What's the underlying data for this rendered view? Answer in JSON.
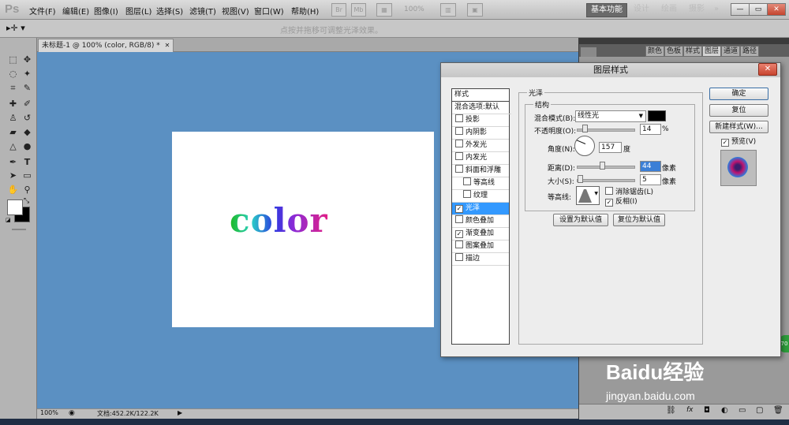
{
  "app": {
    "logo": "Ps"
  },
  "menu": [
    "文件(F)",
    "编辑(E)",
    "图像(I)",
    "图层(L)",
    "选择(S)",
    "滤镜(T)",
    "视图(V)",
    "窗口(W)",
    "帮助(H)"
  ],
  "menubar_tools": {
    "br": "Br",
    "mb": "Mb",
    "zoom": "100%"
  },
  "workspaces": [
    "基本功能",
    "设计",
    "绘画",
    "摄影",
    "»"
  ],
  "window_controls": [
    "—",
    "▭",
    "✕"
  ],
  "options_bar": {
    "hint": "点按并拖移可调整光泽效果。"
  },
  "document": {
    "tab_label": "未标题-1 @ 100% (color, RGB/8) *",
    "tab_close": "✕",
    "canvas_text": "color",
    "status_zoom": "100%",
    "status_doc": "文档:452.2K/122.2K"
  },
  "panel_tabs": [
    "颜色",
    "色板",
    "样式",
    "图层",
    "通道",
    "路径"
  ],
  "layer_style_dialog": {
    "title": "图层样式",
    "close": "✕",
    "styles_header": "样式",
    "styles": [
      {
        "label": "混合选项:默认",
        "checkbox": false,
        "checked": false,
        "indent": false,
        "selected": false
      },
      {
        "label": "投影",
        "checkbox": true,
        "checked": false,
        "indent": false,
        "selected": false
      },
      {
        "label": "内阴影",
        "checkbox": true,
        "checked": false,
        "indent": false,
        "selected": false
      },
      {
        "label": "外发光",
        "checkbox": true,
        "checked": false,
        "indent": false,
        "selected": false
      },
      {
        "label": "内发光",
        "checkbox": true,
        "checked": false,
        "indent": false,
        "selected": false
      },
      {
        "label": "斜面和浮雕",
        "checkbox": true,
        "checked": false,
        "indent": false,
        "selected": false
      },
      {
        "label": "等高线",
        "checkbox": true,
        "checked": false,
        "indent": true,
        "selected": false
      },
      {
        "label": "纹理",
        "checkbox": true,
        "checked": false,
        "indent": true,
        "selected": false
      },
      {
        "label": "光泽",
        "checkbox": true,
        "checked": true,
        "indent": false,
        "selected": true
      },
      {
        "label": "颜色叠加",
        "checkbox": true,
        "checked": false,
        "indent": false,
        "selected": false
      },
      {
        "label": "渐变叠加",
        "checkbox": true,
        "checked": true,
        "indent": false,
        "selected": false
      },
      {
        "label": "图案叠加",
        "checkbox": true,
        "checked": false,
        "indent": false,
        "selected": false
      },
      {
        "label": "描边",
        "checkbox": true,
        "checked": false,
        "indent": false,
        "selected": false
      }
    ],
    "section_title": "光泽",
    "structure_title": "结构",
    "blend_mode_label": "混合模式(B):",
    "blend_mode_value": "线性光",
    "blend_color": "#000000",
    "opacity_label": "不透明度(O):",
    "opacity_value": "14",
    "opacity_unit": "%",
    "angle_label": "角度(N):",
    "angle_value": "157",
    "angle_unit": "度",
    "distance_label": "距离(D):",
    "distance_value": "44",
    "distance_unit": "像素",
    "size_label": "大小(S):",
    "size_value": "5",
    "size_unit": "像素",
    "contour_label": "等高线:",
    "anti_alias_label": "消除锯齿(L)",
    "anti_alias_checked": false,
    "invert_label": "反相(I)",
    "invert_checked": true,
    "set_default": "设置为默认值",
    "reset_default": "复位为默认值",
    "ok": "确定",
    "reset": "复位",
    "new_style": "新建样式(W)...",
    "preview_label": "预览(V)",
    "preview_checked": true
  },
  "watermark": {
    "brand": "Baidu经验",
    "url": "jingyan.baidu.com"
  },
  "badge": "70"
}
